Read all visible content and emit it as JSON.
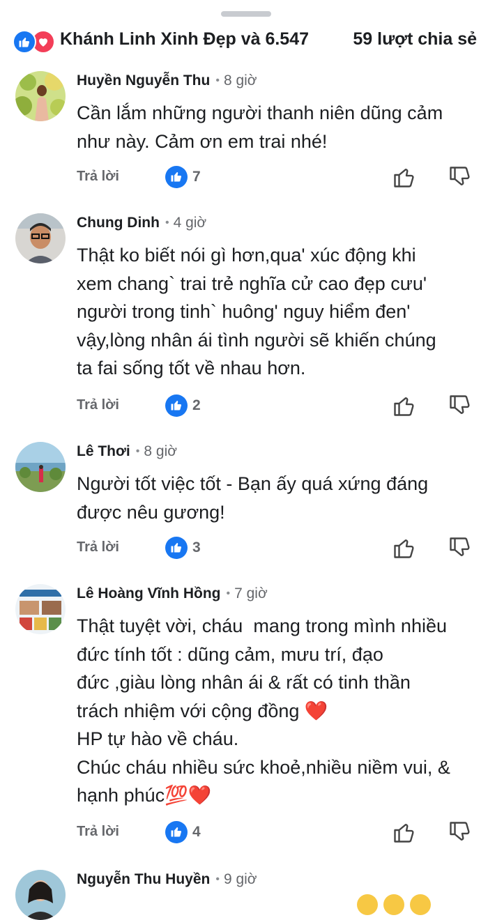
{
  "header": {
    "reactors": "Khánh Linh Xinh Đẹp và 6.547",
    "shares": "59 lượt chia sẻ",
    "reaction_icons": [
      "like-icon",
      "love-icon"
    ]
  },
  "actions": {
    "reply_label": "Trả lời",
    "upvote_icon": "thumbs-up-outline-icon",
    "downvote_icon": "thumbs-down-outline-icon"
  },
  "colors": {
    "like_blue": "#1877f2",
    "love_red": "#f33e58",
    "secondary_text": "#65676b"
  },
  "comments": [
    {
      "author": "Huyền Nguyễn Thu",
      "time": "8 giờ",
      "text": "Cần lắm những người thanh niên dũng cảm\nnhư này. Cảm ơn em trai nhé!",
      "likes": "7"
    },
    {
      "author": "Chung Dinh",
      "time": "4 giờ",
      "text": "Thật ko biết nói gì hơn,qua' xúc động khi\nxem chang` trai trẻ nghĩa cử cao đẹp cưu'\nngười trong tinh` huông' nguy hiểm đen'\nvậy,lòng nhân ái tình người sẽ khiến chúng\nta fai sống tốt về nhau hơn.",
      "likes": "2"
    },
    {
      "author": "Lê Thơi",
      "time": "8 giờ",
      "text": "Người tốt việc tốt - Bạn ấy quá xứng đáng\nđược nêu gương!",
      "likes": "3"
    },
    {
      "author": "Lê Hoàng Vĩnh Hồng",
      "time": "7 giờ",
      "text": "Thật tuyệt vời, cháu  mang trong mình nhiều\nđức tính tốt : dũng cảm, mưu trí, đạo\nđức ,giàu lòng nhân ái & rất có tinh thần\ntrách nhiệm với cộng đồng ❤️\nHP tự hào về cháu.\nChúc cháu nhiều sức khoẻ,nhiều niềm vui, &\nhạnh phúc💯❤️",
      "likes": "4"
    },
    {
      "author": "Nguyễn Thu Huyền",
      "time": "9 giờ"
    }
  ]
}
